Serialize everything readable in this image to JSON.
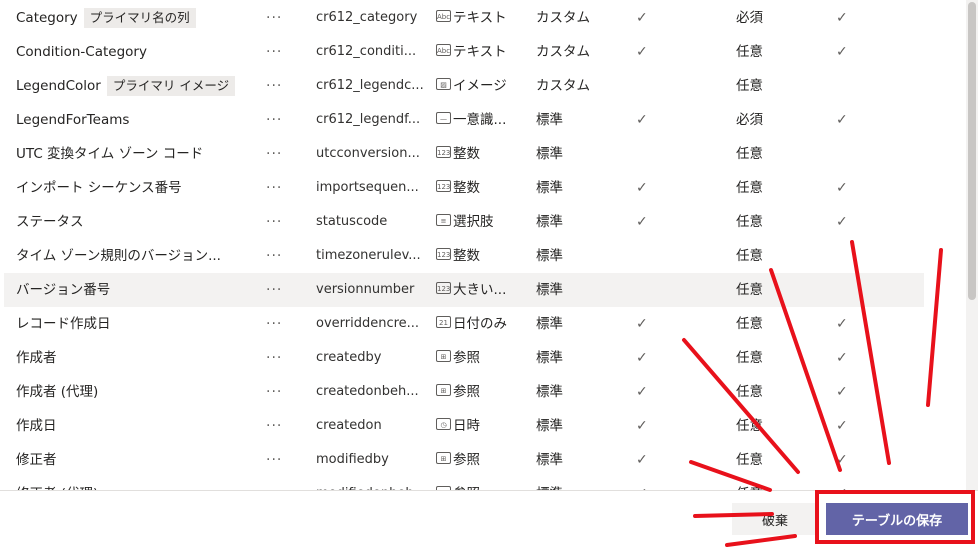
{
  "rows": [
    {
      "name": "Category",
      "tag": "プライマリ名の列",
      "more": "···",
      "schema": "cr612_category",
      "type_icon": "Abc",
      "type": "テキスト",
      "source": "カスタム",
      "check1": "✓",
      "required": "必須",
      "check2": "✓"
    },
    {
      "name": "Condition-Category",
      "tag": "",
      "more": "···",
      "schema": "cr612_conditi...",
      "type_icon": "Abc",
      "type": "テキスト",
      "source": "カスタム",
      "check1": "✓",
      "required": "任意",
      "check2": "✓"
    },
    {
      "name": "LegendColor",
      "tag": "プライマリ イメージ",
      "more": "···",
      "schema": "cr612_legendc...",
      "type_icon": "img",
      "type": "イメージ",
      "source": "カスタム",
      "check1": "",
      "required": "任意",
      "check2": ""
    },
    {
      "name": "LegendForTeams",
      "tag": "",
      "more": "···",
      "schema": "cr612_legendf...",
      "type_icon": "id",
      "type": "一意識...",
      "source": "標準",
      "check1": "✓",
      "required": "必須",
      "check2": "✓"
    },
    {
      "name": "UTC 変換タイム ゾーン コード",
      "tag": "",
      "more": "···",
      "schema": "utcconversion...",
      "type_icon": "123",
      "type": "整数",
      "source": "標準",
      "check1": "",
      "required": "任意",
      "check2": ""
    },
    {
      "name": "インポート シーケンス番号",
      "tag": "",
      "more": "···",
      "schema": "importsequen...",
      "type_icon": "123",
      "type": "整数",
      "source": "標準",
      "check1": "✓",
      "required": "任意",
      "check2": "✓"
    },
    {
      "name": "ステータス",
      "tag": "",
      "more": "···",
      "schema": "statuscode",
      "type_icon": "list",
      "type": "選択肢",
      "source": "標準",
      "check1": "✓",
      "required": "任意",
      "check2": "✓"
    },
    {
      "name": "タイム ゾーン規則のバージョン...",
      "tag": "",
      "more": "···",
      "schema": "timezonerulev...",
      "type_icon": "123",
      "type": "整数",
      "source": "標準",
      "check1": "",
      "required": "任意",
      "check2": ""
    },
    {
      "name": "バージョン番号",
      "tag": "",
      "more": "···",
      "schema": "versionnumber",
      "type_icon": "123",
      "type": "大きい...",
      "source": "標準",
      "check1": "",
      "required": "任意",
      "check2": ""
    },
    {
      "name": "レコード作成日",
      "tag": "",
      "more": "···",
      "schema": "overriddencre...",
      "type_icon": "21",
      "type": "日付のみ",
      "source": "標準",
      "check1": "✓",
      "required": "任意",
      "check2": "✓"
    },
    {
      "name": "作成者",
      "tag": "",
      "more": "···",
      "schema": "createdby",
      "type_icon": "lkp",
      "type": "参照",
      "source": "標準",
      "check1": "✓",
      "required": "任意",
      "check2": "✓"
    },
    {
      "name": "作成者 (代理)",
      "tag": "",
      "more": "···",
      "schema": "createdonbeh...",
      "type_icon": "lkp",
      "type": "参照",
      "source": "標準",
      "check1": "✓",
      "required": "任意",
      "check2": "✓"
    },
    {
      "name": "作成日",
      "tag": "",
      "more": "···",
      "schema": "createdon",
      "type_icon": "dt",
      "type": "日時",
      "source": "標準",
      "check1": "✓",
      "required": "任意",
      "check2": "✓"
    },
    {
      "name": "修正者",
      "tag": "",
      "more": "···",
      "schema": "modifiedby",
      "type_icon": "lkp",
      "type": "参照",
      "source": "標準",
      "check1": "✓",
      "required": "任意",
      "check2": "✓"
    },
    {
      "name": "修正者 (代理)",
      "tag": "",
      "more": "···",
      "schema": "modifiedonbeh...",
      "type_icon": "lkp",
      "type": "参照",
      "source": "標準",
      "check1": "✓",
      "required": "任意",
      "check2": "✓"
    }
  ],
  "selected_row": 8,
  "footer": {
    "discard_label": "破棄",
    "save_label": "テーブルの保存"
  },
  "colors": {
    "accent": "#6264a7",
    "annotation": "#e8111b",
    "selected_row": "#f3f2f1"
  }
}
